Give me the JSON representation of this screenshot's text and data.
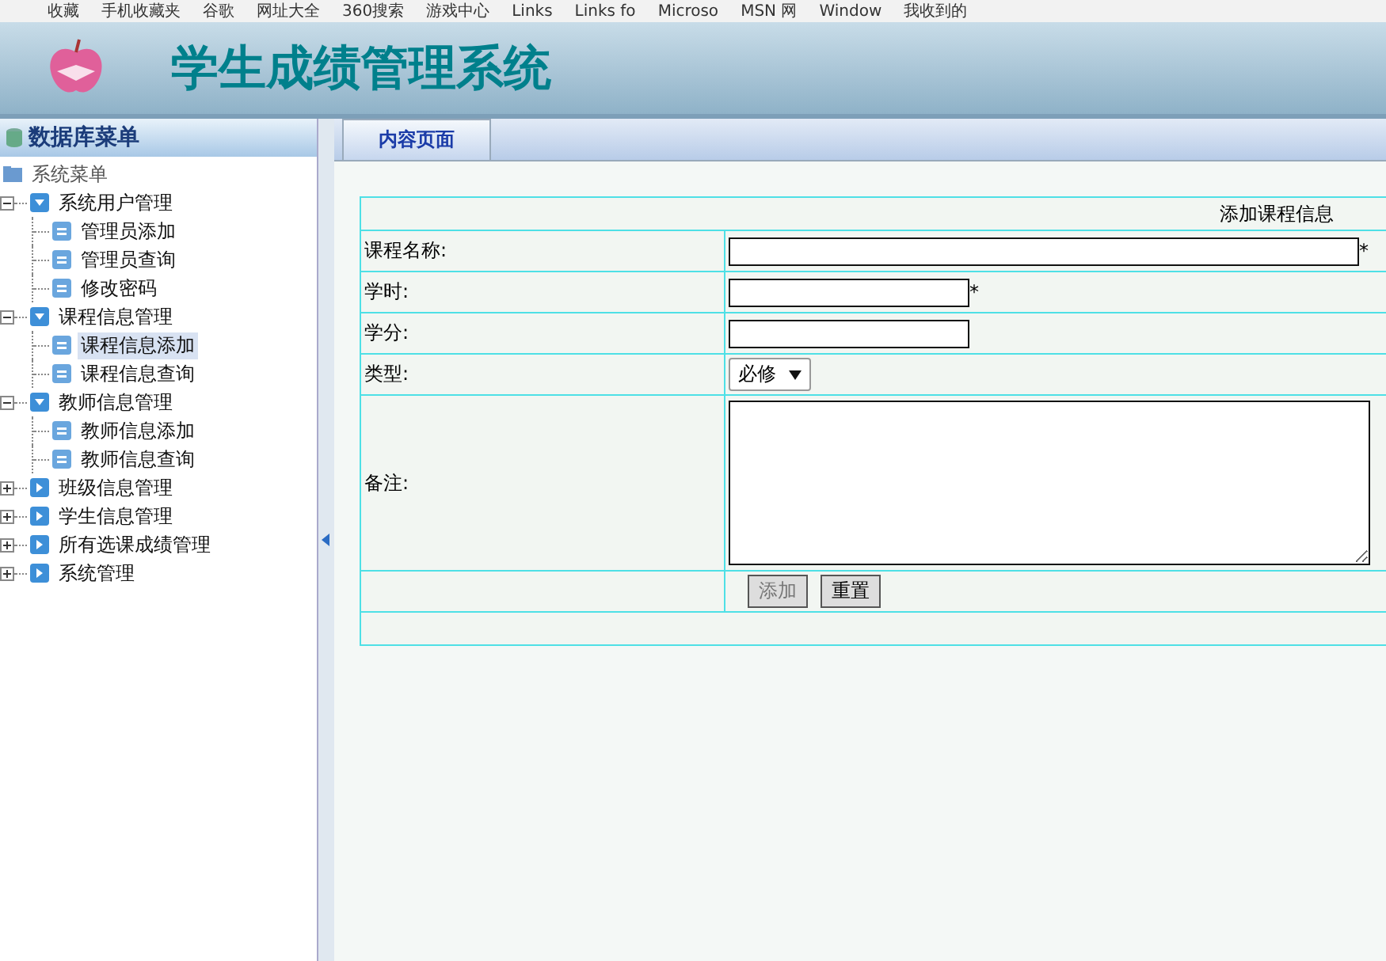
{
  "bookmarks": [
    {
      "label": "收藏"
    },
    {
      "label": "手机收藏夹"
    },
    {
      "label": "谷歌"
    },
    {
      "label": "网址大全"
    },
    {
      "label": "360搜索"
    },
    {
      "label": "游戏中心"
    },
    {
      "label": "Links"
    },
    {
      "label": "Links fo"
    },
    {
      "label": "Microso"
    },
    {
      "label": "MSN 网"
    },
    {
      "label": "Window"
    },
    {
      "label": "我收到的"
    }
  ],
  "header": {
    "title": "学生成绩管理系统"
  },
  "sidebar": {
    "title": "数据库菜单",
    "root": "系统菜单",
    "items": [
      {
        "label": "系统用户管理",
        "expanded": true,
        "children": [
          {
            "label": "管理员添加",
            "selected": false
          },
          {
            "label": "管理员查询",
            "selected": false
          },
          {
            "label": "修改密码",
            "selected": false
          }
        ]
      },
      {
        "label": "课程信息管理",
        "expanded": true,
        "children": [
          {
            "label": "课程信息添加",
            "selected": true
          },
          {
            "label": "课程信息查询",
            "selected": false
          }
        ]
      },
      {
        "label": "教师信息管理",
        "expanded": true,
        "children": [
          {
            "label": "教师信息添加",
            "selected": false
          },
          {
            "label": "教师信息查询",
            "selected": false
          }
        ]
      },
      {
        "label": "班级信息管理",
        "expanded": false
      },
      {
        "label": "学生信息管理",
        "expanded": false
      },
      {
        "label": "所有选课成绩管理",
        "expanded": false
      },
      {
        "label": "系统管理",
        "expanded": false
      }
    ]
  },
  "tabs": [
    {
      "label": "内容页面"
    }
  ],
  "form": {
    "title": "添加课程信息",
    "fields": [
      {
        "label": "课程名称:",
        "kind": "long-text",
        "note": "*"
      },
      {
        "label": "学时:",
        "kind": "short-text",
        "note": "*"
      },
      {
        "label": "学分:",
        "kind": "short-text"
      },
      {
        "label": "类型:",
        "kind": "select",
        "value": "必修"
      },
      {
        "label": "备注:",
        "kind": "textarea"
      }
    ],
    "buttons": [
      "添加",
      "重置"
    ]
  }
}
